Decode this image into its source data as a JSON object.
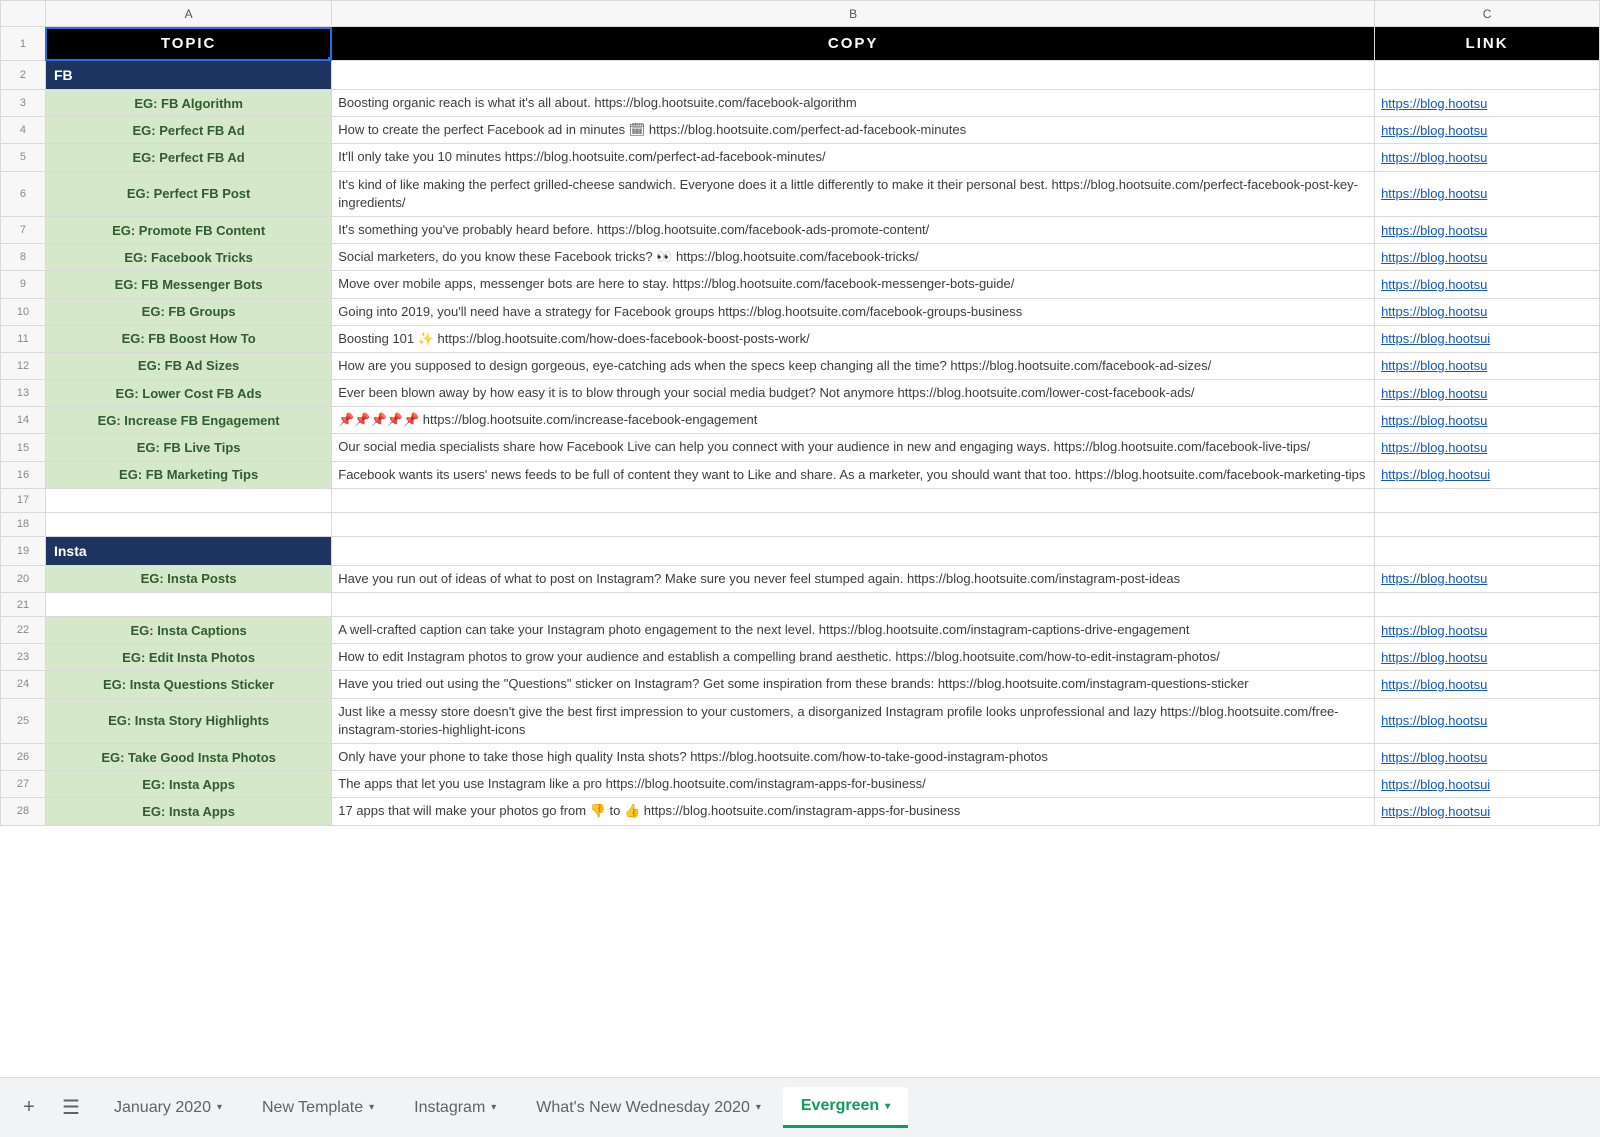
{
  "columns": {
    "A": "A",
    "B": "B",
    "C": "C"
  },
  "headers": {
    "topic": "TOPIC",
    "copy": "COPY",
    "link": "LINK"
  },
  "sections": {
    "fb": "FB",
    "insta": "Insta"
  },
  "rows": [
    {
      "n": 1,
      "type": "header"
    },
    {
      "n": 2,
      "type": "section",
      "key": "fb"
    },
    {
      "n": 3,
      "type": "data",
      "topic": "EG: FB Algorithm",
      "copy": "Boosting organic reach is what it's all about. https://blog.hootsuite.com/facebook-algorithm",
      "link": "https://blog.hootsu"
    },
    {
      "n": 4,
      "type": "data",
      "topic": "EG: Perfect FB Ad",
      "copy": "How to create the perfect Facebook ad in minutes 🗓 https://blog.hootsuite.com/perfect-ad-facebook-minutes",
      "link": "https://blog.hootsu"
    },
    {
      "n": 5,
      "type": "data",
      "topic": "EG: Perfect FB Ad",
      "copy": "It'll only take you 10 minutes https://blog.hootsuite.com/perfect-ad-facebook-minutes/",
      "link": "https://blog.hootsu"
    },
    {
      "n": 6,
      "type": "data",
      "topic": "EG: Perfect FB Post",
      "copy": "It's kind of like making the perfect grilled-cheese sandwich. Everyone does it a little differently to make it their personal best. https://blog.hootsuite.com/perfect-facebook-post-key-ingredients/",
      "link": "https://blog.hootsu"
    },
    {
      "n": 7,
      "type": "data",
      "topic": "EG: Promote FB Content",
      "copy": "It's something you've probably heard before. https://blog.hootsuite.com/facebook-ads-promote-content/",
      "link": "https://blog.hootsu"
    },
    {
      "n": 8,
      "type": "data",
      "topic": "EG: Facebook Tricks",
      "copy": "Social marketers, do you know these Facebook tricks? 👀 https://blog.hootsuite.com/facebook-tricks/",
      "link": "https://blog.hootsu"
    },
    {
      "n": 9,
      "type": "data",
      "topic": "EG: FB Messenger Bots",
      "copy": "Move over mobile apps, messenger bots are here to stay. https://blog.hootsuite.com/facebook-messenger-bots-guide/",
      "link": "https://blog.hootsu"
    },
    {
      "n": 10,
      "type": "data",
      "topic": "EG: FB Groups",
      "copy": "Going into 2019, you'll need have a strategy for Facebook groups https://blog.hootsuite.com/facebook-groups-business",
      "link": "https://blog.hootsu"
    },
    {
      "n": 11,
      "type": "data",
      "topic": "EG: FB Boost How To",
      "copy": "Boosting 101 ✨ https://blog.hootsuite.com/how-does-facebook-boost-posts-work/",
      "link": "https://blog.hootsui"
    },
    {
      "n": 12,
      "type": "data",
      "topic": "EG: FB Ad Sizes",
      "copy": "How are you supposed to design gorgeous, eye-catching ads when the specs keep changing all the time? https://blog.hootsuite.com/facebook-ad-sizes/",
      "link": "https://blog.hootsu"
    },
    {
      "n": 13,
      "type": "data",
      "topic": "EG: Lower Cost FB Ads",
      "copy": "Ever been blown away by how easy it is to blow through your social media budget? Not anymore https://blog.hootsuite.com/lower-cost-facebook-ads/",
      "link": "https://blog.hootsu"
    },
    {
      "n": 14,
      "type": "data",
      "topic": "EG: Increase FB Engagement",
      "copy": "📌📌📌📌📌 https://blog.hootsuite.com/increase-facebook-engagement",
      "link": "https://blog.hootsu"
    },
    {
      "n": 15,
      "type": "data",
      "topic": "EG: FB Live Tips",
      "copy": "Our social media specialists share how Facebook Live can help you connect with your audience in new and engaging ways. https://blog.hootsuite.com/facebook-live-tips/",
      "link": "https://blog.hootsu"
    },
    {
      "n": 16,
      "type": "data",
      "topic": "EG: FB Marketing Tips",
      "copy": "Facebook wants its users' news feeds to be full of content they want to Like and share. As a marketer, you should want that too. https://blog.hootsuite.com/facebook-marketing-tips",
      "link": "https://blog.hootsui"
    },
    {
      "n": 17,
      "type": "empty"
    },
    {
      "n": 18,
      "type": "empty"
    },
    {
      "n": 19,
      "type": "section",
      "key": "insta"
    },
    {
      "n": 20,
      "type": "data",
      "topic": "EG: Insta Posts",
      "copy": "Have you run out of ideas of what to post on Instagram? Make sure you never feel stumped again. https://blog.hootsuite.com/instagram-post-ideas",
      "link": "https://blog.hootsu"
    },
    {
      "n": 21,
      "type": "empty"
    },
    {
      "n": 22,
      "type": "data",
      "topic": "EG: Insta Captions",
      "copy": "A well-crafted caption can take your Instagram photo engagement to the next level. https://blog.hootsuite.com/instagram-captions-drive-engagement",
      "link": "https://blog.hootsu"
    },
    {
      "n": 23,
      "type": "data",
      "topic": "EG: Edit Insta Photos",
      "copy": "How to edit Instagram photos to grow your audience and establish a compelling brand aesthetic. https://blog.hootsuite.com/how-to-edit-instagram-photos/",
      "link": "https://blog.hootsu"
    },
    {
      "n": 24,
      "type": "data",
      "topic": "EG: Insta Questions Sticker",
      "copy": "Have you tried out using the \"Questions\" sticker on Instagram? Get some inspiration from these brands: https://blog.hootsuite.com/instagram-questions-sticker",
      "link": "https://blog.hootsu"
    },
    {
      "n": 25,
      "type": "data",
      "topic": "EG: Insta Story Highlights",
      "copy": "Just like a messy store doesn't give the best first impression to your customers, a disorganized Instagram profile looks unprofessional and lazy https://blog.hootsuite.com/free-instagram-stories-highlight-icons",
      "link": "https://blog.hootsu"
    },
    {
      "n": 26,
      "type": "data",
      "topic": "EG: Take Good Insta Photos",
      "copy": "Only have your phone to take those high quality Insta shots? https://blog.hootsuite.com/how-to-take-good-instagram-photos",
      "link": "https://blog.hootsu"
    },
    {
      "n": 27,
      "type": "data",
      "topic": "EG: Insta Apps",
      "copy": "The apps that let you use Instagram like a pro https://blog.hootsuite.com/instagram-apps-for-business/",
      "link": "https://blog.hootsui"
    },
    {
      "n": 28,
      "type": "data",
      "topic": "EG: Insta Apps",
      "copy": "17 apps that will make your photos go from 👎 to 👍 https://blog.hootsuite.com/instagram-apps-for-business",
      "link": "https://blog.hootsui"
    }
  ],
  "tabs": [
    {
      "label": "January 2020",
      "active": false
    },
    {
      "label": "New Template",
      "active": false
    },
    {
      "label": "Instagram",
      "active": false
    },
    {
      "label": "What's New Wednesday 2020",
      "active": false
    },
    {
      "label": "Evergreen",
      "active": true
    }
  ]
}
